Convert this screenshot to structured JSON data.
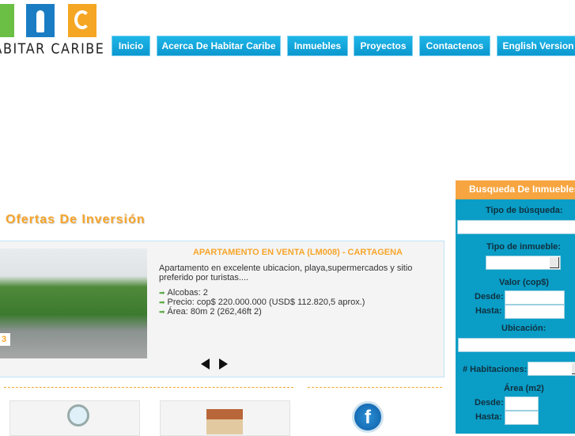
{
  "logo": {
    "text": "HABITAR CARIBE",
    "colors": [
      "#6cbf45",
      "#1a7dc4",
      "#f5a623"
    ]
  },
  "nav": [
    "Inicio",
    "Acerca De Habitar Caribe",
    "Inmuebles",
    "Proyectos",
    "Contactenos",
    "English Version"
  ],
  "offers": {
    "heading": "Ofertas De Inversión",
    "slide_number": "3",
    "title": "APARTAMENTO EN VENTA (LM008) - CARTAGENA",
    "description": "Apartamento en excelente ubicacion, playa,supermercados y sitio preferido por turistas....",
    "features": [
      "Alcobas: 2",
      "Precio: cop$ 220.000.000 (USD$ 112.820,5 aprox.)",
      "Área: 80m 2 (262,46ft 2)"
    ]
  },
  "search": {
    "title": "Busqueda De Inmuebles",
    "tipo_busqueda": "Tipo de búsqueda:",
    "tipo_inmueble": "Tipo de inmueble:",
    "valor": "Valor (cop$)",
    "desde": "Desde:",
    "hasta": "Hasta:",
    "ubicacion": "Ubicación:",
    "habitaciones": "# Habitaciones:",
    "area": "Área (m2)"
  }
}
